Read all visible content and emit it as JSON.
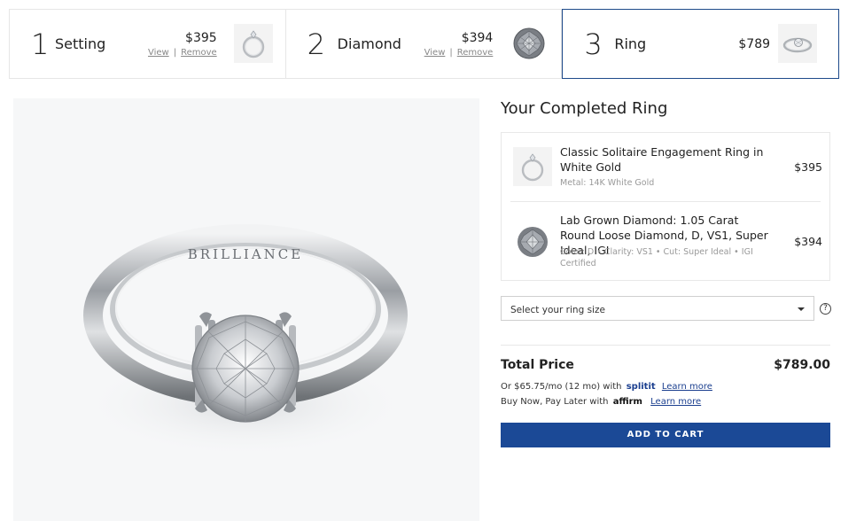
{
  "steps": [
    {
      "number": "1",
      "label": "Setting",
      "price": "$395",
      "view_label": "View",
      "separator": "|",
      "remove_label": "Remove",
      "thumb_icon": "ring-setting-icon"
    },
    {
      "number": "2",
      "label": "Diamond",
      "price": "$394",
      "view_label": "View",
      "separator": "|",
      "remove_label": "Remove",
      "thumb_icon": "diamond-icon"
    },
    {
      "number": "3",
      "label": "Ring",
      "price": "$789",
      "thumb_icon": "completed-ring-icon"
    }
  ],
  "hero": {
    "engraving": "BRILLIANCE"
  },
  "panel": {
    "title": "Your Completed Ring",
    "items": [
      {
        "name": "Classic Solitaire Engagement Ring in White Gold",
        "meta": "Metal: 14K White Gold",
        "price": "$395"
      },
      {
        "name": "Lab Grown Diamond: 1.05 Carat Round Loose Diamond, D, VS1, Super Ideal, IGI",
        "meta": "Color: D • Clarity: VS1 • Cut: Super Ideal • IGI Certified",
        "price": "$394"
      }
    ],
    "ring_size_placeholder": "Select your ring size",
    "help_icon": "?",
    "total_label": "Total Price",
    "total_value": "$789.00",
    "finance1_prefix": "Or $65.75/mo (12 mo) with",
    "finance1_brand": "splitit",
    "finance1_link": "Learn more",
    "finance2_prefix": "Buy Now, Pay Later with",
    "finance2_brand": "affirm",
    "finance2_link": "Learn more",
    "add_to_cart": "ADD TO CART"
  },
  "colors": {
    "accent": "#1b4996",
    "active_border": "#1e4a8a",
    "link": "#1b3f8f"
  }
}
